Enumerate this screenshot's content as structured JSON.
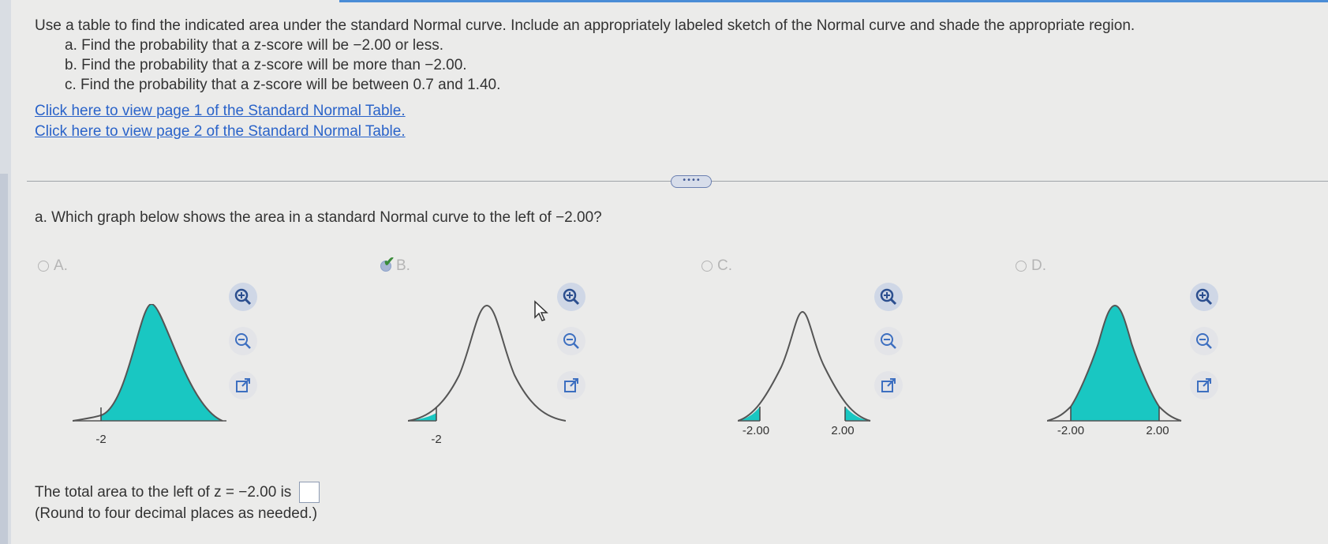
{
  "question": {
    "intro": "Use a table to find the indicated area under the standard Normal curve. Include an appropriately labeled sketch of the Normal curve and shade the appropriate region.",
    "parts": [
      "a. Find the probability that a z-score will be −2.00 or less.",
      "b. Find the probability that a z-score will be more than −2.00.",
      "c. Find the probability that a z-score will be between 0.7 and 1.40."
    ]
  },
  "links": [
    "Click here to view page 1 of the Standard Normal Table.",
    "Click here to view page 2 of the Standard Normal Table."
  ],
  "more_button": "••••",
  "part_a": {
    "question": "a. Which graph below shows the area in a standard Normal curve to the left of −2.00?"
  },
  "options": [
    {
      "label": "A.",
      "selected": false,
      "shading": "left-of-cutoff",
      "ticks": [
        "-2"
      ]
    },
    {
      "label": "B.",
      "selected": true,
      "shading": "left-tail",
      "ticks": [
        "-2"
      ]
    },
    {
      "label": "C.",
      "selected": false,
      "shading": "both-tails",
      "ticks": [
        "-2.00",
        "2.00"
      ]
    },
    {
      "label": "D.",
      "selected": false,
      "shading": "between",
      "ticks": [
        "-2.00",
        "2.00"
      ]
    }
  ],
  "tool_icons": [
    "zoom-in-icon",
    "zoom-out-icon",
    "popout-icon"
  ],
  "answer": {
    "prompt": "The total area to the left of z = −2.00 is",
    "value": "",
    "note": "(Round to four decimal places as needed.)"
  },
  "colors": {
    "shade": "#19c7c2",
    "curve": "#555555",
    "link": "#2a63c9"
  }
}
